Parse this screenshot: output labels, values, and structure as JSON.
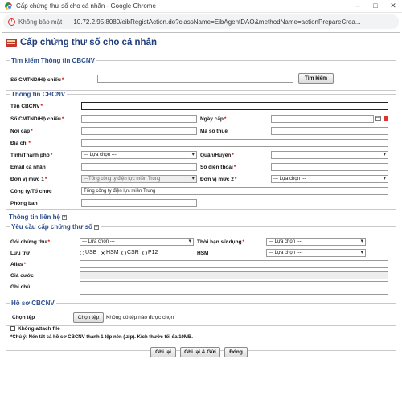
{
  "window": {
    "title": "Cấp chứng thư số cho cá nhân - Google Chrome",
    "controls": [
      "–",
      "□",
      "✕"
    ]
  },
  "addressbar": {
    "security": "Không bảo mật",
    "url": "10.72.2.95:8080/eibRegistAction.do?className=EibAgentDAO&methodName=actionPrepareCrea..."
  },
  "page": {
    "title": "Cấp chứng thư số cho cá nhân"
  },
  "search": {
    "title": "Tìm kiếm Thông tin CBCNV",
    "id_label": "Số CMTND/Hộ chiếu",
    "id_value": "",
    "button": "Tìm kiếm"
  },
  "staff": {
    "title": "Thông tin CBCNV",
    "name_label": "Tên CBCNV",
    "id_label": "Số CMTND/Hộ chiếu",
    "issue_date_label": "Ngày cấp",
    "issue_place_label": "Nơi cấp",
    "tax_label": "Mã số thuế",
    "address_label": "Địa chỉ",
    "province_label": "Tỉnh/Thành phố",
    "province_value": "--- Lựa chọn ---",
    "district_label": "Quận/Huyện",
    "district_value": "",
    "email_label": "Email cá nhân",
    "phone_label": "Số điện thoại",
    "unit1_label": "Đơn vị mức 1",
    "unit1_value": "---Tổng công ty điện lực miền Trung",
    "unit2_label": "Đơn vị mức 2",
    "unit2_value": "--- Lựa chọn ---",
    "company_label": "Công ty/Tổ chức",
    "company_value": "Tổng công ty điện lực miền Trung",
    "room_label": "Phòng ban"
  },
  "contact": {
    "title": "Thông tin liên hệ",
    "toggle": "+"
  },
  "request": {
    "title": "Yêu cầu cấp chứng thư số",
    "toggle": "–",
    "package_label": "Gói chứng thư",
    "package_value": "--- Lựa chọn ---",
    "term_label": "Thời hạn sử dụng",
    "term_value": "--- Lựa chọn ---",
    "storage_label": "Lưu trữ",
    "storage_options": [
      "USB",
      "HSM",
      "CSR",
      "P12"
    ],
    "storage_selected": "HSM",
    "hsm_label": "HSM",
    "hsm_value": "--- Lựa chọn ---",
    "alias_label": "Alias",
    "price_label": "Giá cước",
    "note_label": "Ghi chú"
  },
  "profile": {
    "title": "Hồ sơ CBCNV",
    "file_label": "Chọn tệp",
    "file_button": "Chọn tệp",
    "file_status": "Không có tệp nào được chọn",
    "no_attach_label": "Không attach file",
    "note": "*Chú ý: Nén tất cả hồ sơ CBCNV thành 1 tệp nén (.zip). Kích thước tối đa 10MB."
  },
  "actions": {
    "save": "Ghi lại",
    "save_send": "Ghi lại & Gửi",
    "close": "Đóng"
  },
  "colors": {
    "section_title": "#2b4c8c",
    "page_title": "#1f3d7a",
    "required": "#dd0000"
  }
}
